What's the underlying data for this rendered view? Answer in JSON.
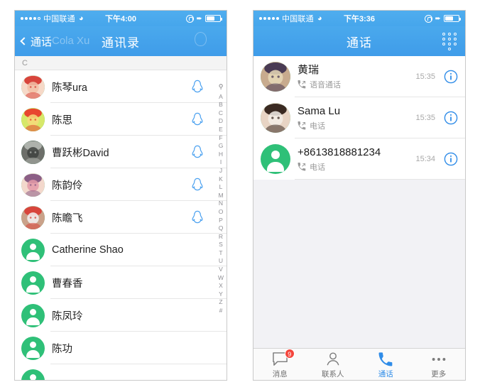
{
  "left_phone": {
    "status_bar": {
      "carrier": "中国联通",
      "signal_dots": 5,
      "signal_filled": 4,
      "wifi_icon": "wifi-icon",
      "time": "下午4:00",
      "lock_icon": "rotation-lock-icon",
      "location_icon": "location-arrow-icon",
      "battery_icon": "battery-icon",
      "battery_level": 62
    },
    "nav": {
      "back_label": "通话",
      "title": "通讯录",
      "back_icon": "chevron-left-icon"
    },
    "watermark": {
      "text": "Cola Xu",
      "icon": "qq-penguin-icon"
    },
    "section_header": "C",
    "contacts": [
      {
        "name": "陈琴ura",
        "avatar": "photo-baby-redhat",
        "avatar_type": "photo",
        "action_icon": "qq-call-icon"
      },
      {
        "name": "陈思",
        "avatar": "photo-cartoon",
        "avatar_type": "photo",
        "action_icon": "qq-call-icon"
      },
      {
        "name": "曹跃彬David",
        "avatar": "photo-koala",
        "avatar_type": "photo",
        "action_icon": "qq-call-icon"
      },
      {
        "name": "陈韵伶",
        "avatar": "photo-girl",
        "avatar_type": "photo",
        "action_icon": "qq-call-icon"
      },
      {
        "name": "陈瞻飞",
        "avatar": "photo-santa-baby",
        "avatar_type": "photo",
        "action_icon": "qq-call-icon"
      },
      {
        "name": "Catherine Shao",
        "avatar": "default-person",
        "avatar_type": "default",
        "action_icon": ""
      },
      {
        "name": "曹春香",
        "avatar": "default-person",
        "avatar_type": "default",
        "action_icon": ""
      },
      {
        "name": "陈凤玲",
        "avatar": "default-person",
        "avatar_type": "default",
        "action_icon": ""
      },
      {
        "name": "陈功",
        "avatar": "default-person",
        "avatar_type": "default",
        "action_icon": ""
      },
      {
        "name": "",
        "avatar": "default-person",
        "avatar_type": "default",
        "action_icon": ""
      }
    ],
    "index_strip": {
      "search_icon": "search-icon",
      "letters": [
        "A",
        "B",
        "C",
        "D",
        "E",
        "F",
        "G",
        "H",
        "I",
        "J",
        "K",
        "L",
        "M",
        "N",
        "O",
        "P",
        "Q",
        "R",
        "S",
        "T",
        "U",
        "V",
        "W",
        "X",
        "Y",
        "Z",
        "#"
      ]
    }
  },
  "right_phone": {
    "status_bar": {
      "carrier": "中国联通",
      "signal_dots": 5,
      "signal_filled": 5,
      "wifi_icon": "wifi-icon",
      "time": "下午3:36",
      "lock_icon": "rotation-lock-icon",
      "location_icon": "location-arrow-icon",
      "battery_icon": "battery-icon",
      "battery_level": 62
    },
    "nav": {
      "title": "通话",
      "dialpad_icon": "dialpad-icon"
    },
    "calls": [
      {
        "name": "黄瑞",
        "type": "语音通话",
        "time": "15:35",
        "avatar": "photo-portrait-man",
        "avatar_type": "photo",
        "type_icon": "outgoing-call-icon",
        "info_icon": "info-icon"
      },
      {
        "name": "Sama Lu",
        "type": "电话",
        "time": "15:35",
        "avatar": "photo-child",
        "avatar_type": "photo",
        "type_icon": "outgoing-call-icon",
        "info_icon": "info-icon"
      },
      {
        "name": "+8613818881234",
        "type": "电话",
        "time": "15:34",
        "avatar": "default-person",
        "avatar_type": "default",
        "type_icon": "outgoing-call-icon",
        "info_icon": "info-icon"
      }
    ],
    "tabs": [
      {
        "label": "消息",
        "icon": "message-bubble-icon",
        "badge": "9",
        "active": false
      },
      {
        "label": "联系人",
        "icon": "person-icon",
        "badge": "",
        "active": false
      },
      {
        "label": "通话",
        "icon": "phone-handset-icon",
        "badge": "",
        "active": true
      },
      {
        "label": "更多",
        "icon": "ellipsis-icon",
        "badge": "",
        "active": false
      }
    ]
  },
  "colors": {
    "nav_blue_top": "#4aa9ed",
    "nav_blue_bottom": "#3f9ce9",
    "accent_blue": "#2f8ce8",
    "avatar_green": "#2fc078",
    "badge_red": "#f4453c",
    "filler_gray": "#f2f2f5"
  }
}
